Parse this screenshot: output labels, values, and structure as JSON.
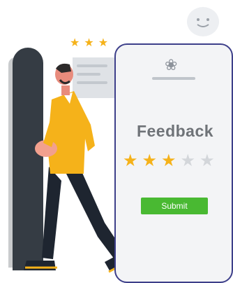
{
  "feedback_card": {
    "title": "Feedback",
    "rating": 3,
    "max_rating": 5,
    "submit_label": "Submit"
  },
  "top_stars": 3,
  "colors": {
    "star_filled": "#f5b21a",
    "star_empty": "#d3d6da",
    "submit": "#49b932",
    "phone_border": "#3d3f8a",
    "shirt": "#f5b21a",
    "pants": "#1e2530"
  },
  "icons": {
    "card_logo": "logo-icon",
    "emoji": "happy-face-icon",
    "star": "star-icon"
  }
}
